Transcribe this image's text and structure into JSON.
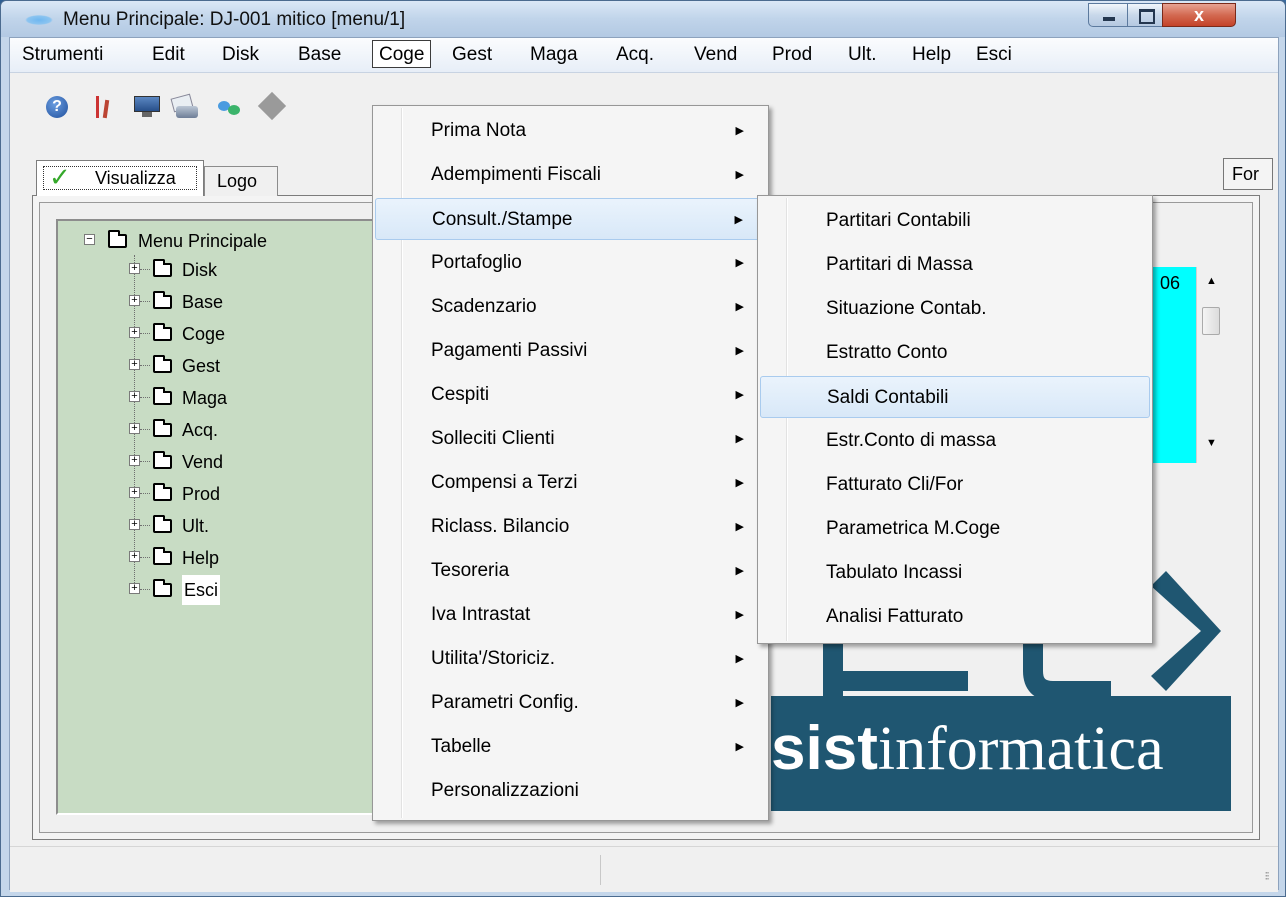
{
  "window": {
    "title": "Menu Principale: DJ-001 mitico [menu/1]",
    "close_glyph": "x"
  },
  "menubar": [
    {
      "id": "strumenti",
      "label": "Strumenti"
    },
    {
      "id": "edit",
      "label": "Edit"
    },
    {
      "id": "disk",
      "label": "Disk"
    },
    {
      "id": "base",
      "label": "Base"
    },
    {
      "id": "coge",
      "label": "Coge"
    },
    {
      "id": "gest",
      "label": "Gest"
    },
    {
      "id": "maga",
      "label": "Maga"
    },
    {
      "id": "acq",
      "label": "Acq."
    },
    {
      "id": "vend",
      "label": "Vend"
    },
    {
      "id": "prod",
      "label": "Prod"
    },
    {
      "id": "ult",
      "label": "Ult."
    },
    {
      "id": "help",
      "label": "Help"
    },
    {
      "id": "esci",
      "label": "Esci"
    }
  ],
  "toolbar": {
    "help_glyph": "?",
    "icons": [
      "help-icon",
      "tools-icon",
      "monitor-icon",
      "printer-icon",
      "link-icon",
      "diamond-icon"
    ]
  },
  "tabs": {
    "visualizza": "Visualizza",
    "logo": "Logo",
    "for": "For"
  },
  "tree": {
    "root": "Menu Principale",
    "items": [
      "Disk",
      "Base",
      "Coge",
      "Gest",
      "Maga",
      "Acq.",
      "Vend",
      "Prod",
      "Ult.",
      "Help",
      "Esci"
    ],
    "selected": "Esci",
    "expand_glyph": "+",
    "collapse_glyph": "−"
  },
  "list_panel": {
    "visible_text": "06",
    "color": "#00ffff"
  },
  "logo": {
    "text_bold": "sist",
    "text_regular": "informatica",
    "bar_color": "#1f5671"
  },
  "coge_menu": [
    {
      "label": "Prima Nota",
      "submenu": true
    },
    {
      "label": "Adempimenti Fiscali",
      "submenu": true
    },
    {
      "label": "Consult./Stampe",
      "submenu": true,
      "highlighted": true
    },
    {
      "label": "Portafoglio",
      "submenu": true
    },
    {
      "label": "Scadenzario",
      "submenu": true
    },
    {
      "label": "Pagamenti Passivi",
      "submenu": true
    },
    {
      "label": "Cespiti",
      "submenu": true
    },
    {
      "label": "Solleciti Clienti",
      "submenu": true
    },
    {
      "label": "Compensi a Terzi",
      "submenu": true
    },
    {
      "label": "Riclass. Bilancio",
      "submenu": true
    },
    {
      "label": "Tesoreria",
      "submenu": true
    },
    {
      "label": "Iva Intrastat",
      "submenu": true
    },
    {
      "label": "Utilita'/Storiciz.",
      "submenu": true
    },
    {
      "label": "Parametri Config.",
      "submenu": true
    },
    {
      "label": "Tabelle",
      "submenu": true
    },
    {
      "label": "Personalizzazioni",
      "submenu": false
    }
  ],
  "consult_menu": [
    {
      "label": "Partitari Contabili"
    },
    {
      "label": "Partitari di Massa"
    },
    {
      "label": "Situazione Contab."
    },
    {
      "label": "Estratto Conto"
    },
    {
      "label": "Saldi Contabili",
      "highlighted": true
    },
    {
      "label": "Estr.Conto di massa"
    },
    {
      "label": "Fatturato Cli/For"
    },
    {
      "label": "Parametrica M.Coge"
    },
    {
      "label": "Tabulato Incassi"
    },
    {
      "label": "Analisi Fatturato"
    }
  ],
  "submenu_arrow": "▶",
  "scroll": {
    "up": "▲",
    "down": "▼"
  },
  "grip": "⁝⁝"
}
